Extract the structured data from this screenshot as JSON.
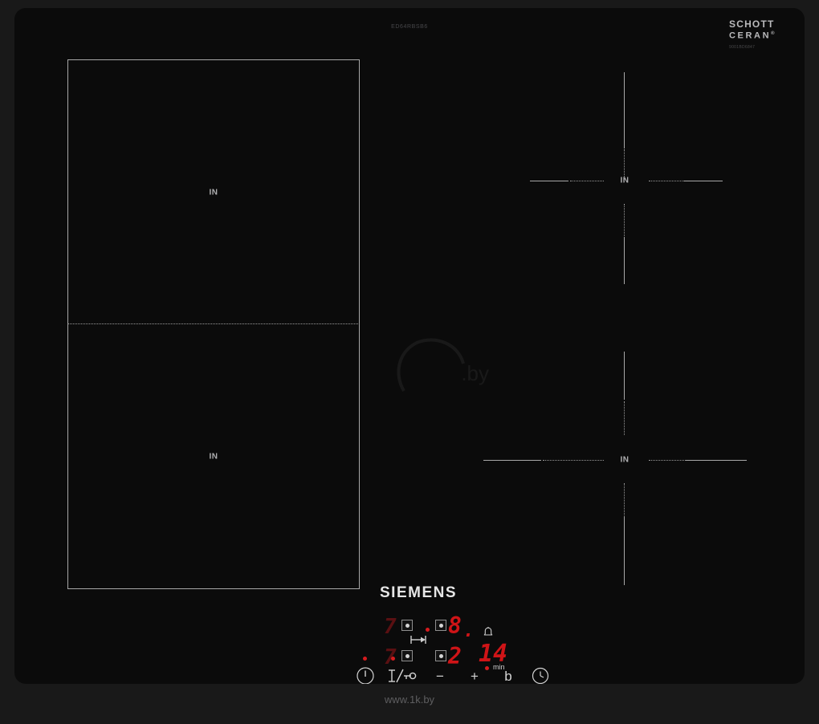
{
  "product": {
    "brand": "SIEMENS",
    "model_code": "ED64RBSB6",
    "glass_brand_line1": "SCHOTT",
    "glass_brand_line2": "CERAN",
    "glass_brand_reg": "®",
    "glass_serial": "9001BD6847"
  },
  "colors": {
    "glass": "#0b0b0b",
    "backdrop": "#191919",
    "zone_outline": "#a8a8a8",
    "display_red": "#cf1417",
    "display_red_dim": "#5a1012",
    "indicator_red": "#d61b1e",
    "label_text": "#d8d8d8"
  },
  "zones": {
    "flex_left": {
      "name": "flexInduction zone",
      "top_label": "IN",
      "bottom_label": "IN"
    },
    "right_top": {
      "name": "Induction zone rear right",
      "label": "IN"
    },
    "right_bottom": {
      "name": "Induction zone front right",
      "label": "IN"
    }
  },
  "display": {
    "rear_left_level": "7",
    "front_left_level": "7",
    "rear_right_level": "8",
    "front_right_level": "2",
    "timer_value": "14",
    "timer_unit": "min",
    "flexzone_link_icon": "flexzone-link-icon",
    "timer_bell_icon": "bell-icon",
    "decimal_point": "."
  },
  "buttons": [
    {
      "id": "power",
      "name": "power-button",
      "glyph": "ⓘ",
      "label": ""
    },
    {
      "id": "childlock",
      "name": "child-lock-button",
      "glyph": "",
      "label": ""
    },
    {
      "id": "minus",
      "name": "minus-button",
      "glyph": "−",
      "label": "−"
    },
    {
      "id": "plus",
      "name": "plus-button",
      "glyph": "+",
      "label": "+"
    },
    {
      "id": "boost",
      "name": "powerboost-button",
      "glyph": "b",
      "label": "b"
    },
    {
      "id": "timer",
      "name": "timer-button",
      "glyph": "",
      "label": ""
    }
  ],
  "watermarks": {
    "center": ".by",
    "bottom": "www.1k.by"
  }
}
